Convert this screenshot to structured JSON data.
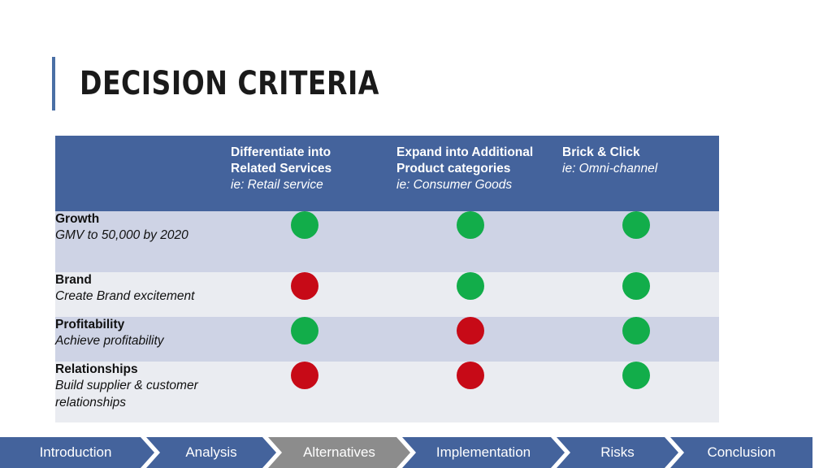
{
  "slide": {
    "title": "Decision Criteria"
  },
  "table": {
    "corner": "",
    "columns": [
      {
        "name": "Differentiate into Related Services",
        "note": "ie: Retail service"
      },
      {
        "name": "Expand into Additional Product categories",
        "note": "ie: Consumer Goods"
      },
      {
        "name": "Brick & Click",
        "note": "ie: Omni-channel"
      }
    ],
    "rows": [
      {
        "criterion": "Growth",
        "detail": "GMV to 50,000 by 2020",
        "ratings": [
          "green",
          "green",
          "green"
        ]
      },
      {
        "criterion": "Brand",
        "detail": "Create Brand excitement",
        "ratings": [
          "red",
          "green",
          "green"
        ]
      },
      {
        "criterion": "Profitability",
        "detail": "Achieve profitability",
        "ratings": [
          "green",
          "red",
          "green"
        ]
      },
      {
        "criterion": "Relationships",
        "detail": "Build supplier & customer relationships",
        "ratings": [
          "red",
          "red",
          "green"
        ]
      }
    ]
  },
  "nav": {
    "items": [
      {
        "label": "Introduction",
        "active": false
      },
      {
        "label": "Analysis",
        "active": false
      },
      {
        "label": "Alternatives",
        "active": true
      },
      {
        "label": "Implementation",
        "active": false
      },
      {
        "label": "Risks",
        "active": false
      },
      {
        "label": "Conclusion",
        "active": false
      }
    ]
  },
  "colors": {
    "header_blue": "#44639c",
    "row_alt": "#ced3e5",
    "row_base": "#eaecf1",
    "green": "#12ad4a",
    "red": "#c70a17",
    "active_gray": "#8c8c8c"
  }
}
